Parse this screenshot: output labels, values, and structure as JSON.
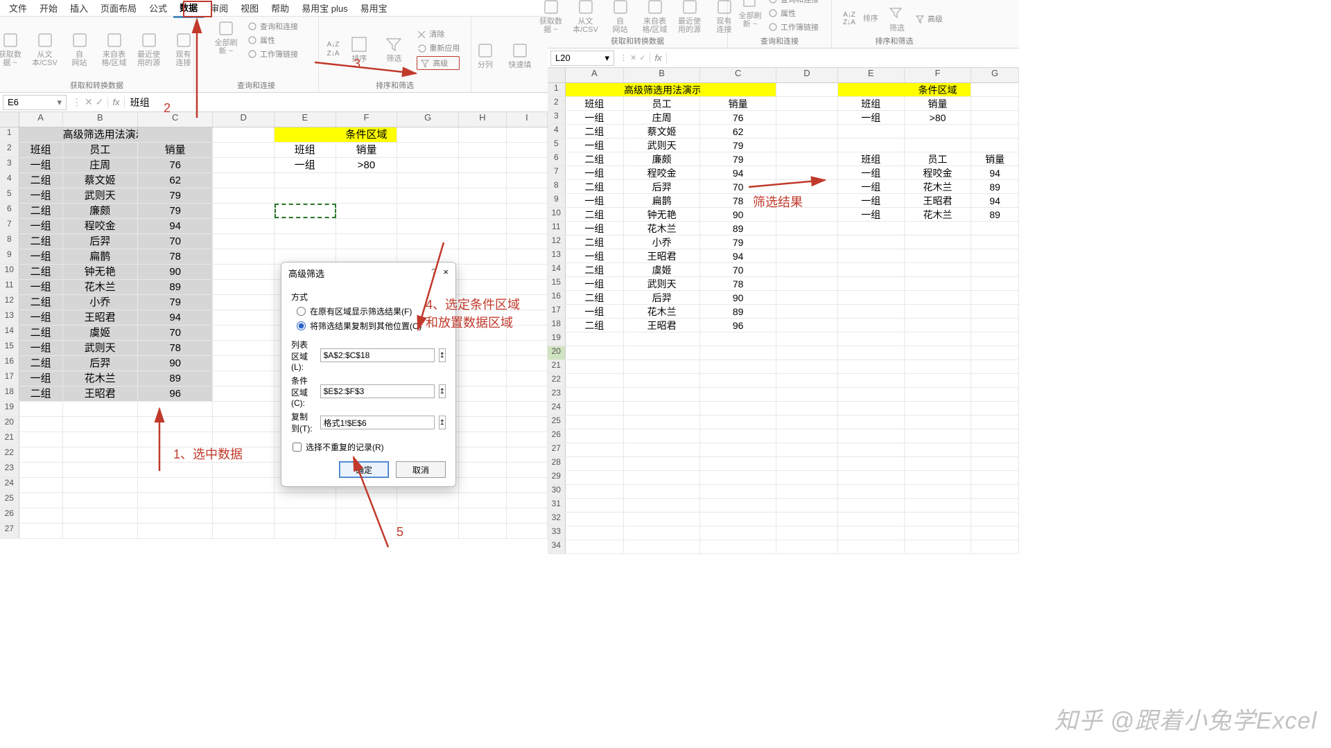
{
  "menu": [
    "文件",
    "开始",
    "插入",
    "页面布局",
    "公式",
    "数据",
    "审阅",
    "视图",
    "帮助",
    "易用宝 plus",
    "易用宝"
  ],
  "menu_active": "数据",
  "ribbon": {
    "g1": {
      "label": "获取和转换数据",
      "items": [
        "获取数\n据 ~",
        "从文\n本/CSV",
        "自\n网站",
        "来自表\n格/区域",
        "最近使\n用的源",
        "现有\n连接"
      ]
    },
    "g2": {
      "label": "查询和连接",
      "big": "全部刷\n新 ~",
      "subs": [
        "查询和连接",
        "属性",
        "工作簿链接"
      ]
    },
    "g3": {
      "label": "排序和筛选",
      "sortA": "A↓Z",
      "sortZ": "Z↓A",
      "sort": "排序",
      "filter": "筛选",
      "subs": [
        "清除",
        "重新应用",
        "高级"
      ]
    },
    "g4": {
      "items": [
        "分列",
        "快速填"
      ]
    }
  },
  "left_fbar": {
    "name": "E6",
    "fx": "fx",
    "val": "班组"
  },
  "left_cols": [
    "A",
    "B",
    "C",
    "D",
    "E",
    "F",
    "G",
    "H",
    "I"
  ],
  "left_widths": [
    64,
    110,
    110,
    90,
    90,
    90,
    90,
    70,
    60
  ],
  "left_title": "高级筛选用法演示",
  "left_hdrs": [
    "班组",
    "员工",
    "销量"
  ],
  "left_data": [
    [
      "一组",
      "庄周",
      76
    ],
    [
      "二组",
      "蔡文姬",
      62
    ],
    [
      "一组",
      "武则天",
      79
    ],
    [
      "二组",
      "廉颇",
      79
    ],
    [
      "一组",
      "程咬金",
      94
    ],
    [
      "二组",
      "后羿",
      70
    ],
    [
      "一组",
      "扁鹊",
      78
    ],
    [
      "二组",
      "钟无艳",
      90
    ],
    [
      "一组",
      "花木兰",
      89
    ],
    [
      "二组",
      "小乔",
      79
    ],
    [
      "一组",
      "王昭君",
      94
    ],
    [
      "二组",
      "虞姬",
      70
    ],
    [
      "一组",
      "武则天",
      78
    ],
    [
      "二组",
      "后羿",
      90
    ],
    [
      "一组",
      "花木兰",
      89
    ],
    [
      "二组",
      "王昭君",
      96
    ]
  ],
  "cond_title": "条件区域",
  "cond_hdrs": [
    "班组",
    "销量"
  ],
  "cond_vals": [
    "一组",
    ">80"
  ],
  "dlg": {
    "title": "高级筛选",
    "help": "?",
    "close": "×",
    "method": "方式",
    "r1": "在原有区域显示筛选结果(F)",
    "r2": "将筛选结果复制到其他位置(O)",
    "f1l": "列表区域(L):",
    "f1v": "$A$2:$C$18",
    "f2l": "条件区域(C):",
    "f2v": "$E$2:$F$3",
    "f3l": "复制到(T):",
    "f3v": "格式1!$E$6",
    "chk": "选择不重复的记录(R)",
    "ok": "确定",
    "cancel": "取消"
  },
  "annos": {
    "a1": "1、选中数据",
    "a2": "2",
    "a3": "3",
    "a4": "4、选定条件区域\n和放置数据区域",
    "a5": "5",
    "res": "筛选结果"
  },
  "right_fbar": {
    "name": "L20",
    "fx": "fx",
    "val": ""
  },
  "right_cols": [
    "A",
    "B",
    "C",
    "D",
    "E",
    "F",
    "G"
  ],
  "right_widths": [
    86,
    112,
    112,
    90,
    98,
    98,
    70
  ],
  "right_result_hdrs": [
    "班组",
    "员工",
    "销量"
  ],
  "right_result": [
    [
      "一组",
      "程咬金",
      94
    ],
    [
      "一组",
      "花木兰",
      89
    ],
    [
      "一组",
      "王昭君",
      94
    ],
    [
      "一组",
      "花木兰",
      89
    ]
  ],
  "rgR": {
    "label": "获取和转换数据",
    "items": [
      "获取数\n据 ~",
      "从文\n本/CSV",
      "自\n网站",
      "来自表\n格/区域",
      "最近使\n用的源",
      "现有\n连接"
    ]
  },
  "rgR2": {
    "label": "查询和连接",
    "big": "全部刷\n新 ~",
    "subs": [
      "查询和连接",
      "属性",
      "工作簿链接"
    ]
  },
  "rgR3": {
    "label": "排序和筛选",
    "subs": [
      "排序",
      "筛选",
      "高级"
    ]
  },
  "watermark": "知乎 @跟着小兔学Excel"
}
